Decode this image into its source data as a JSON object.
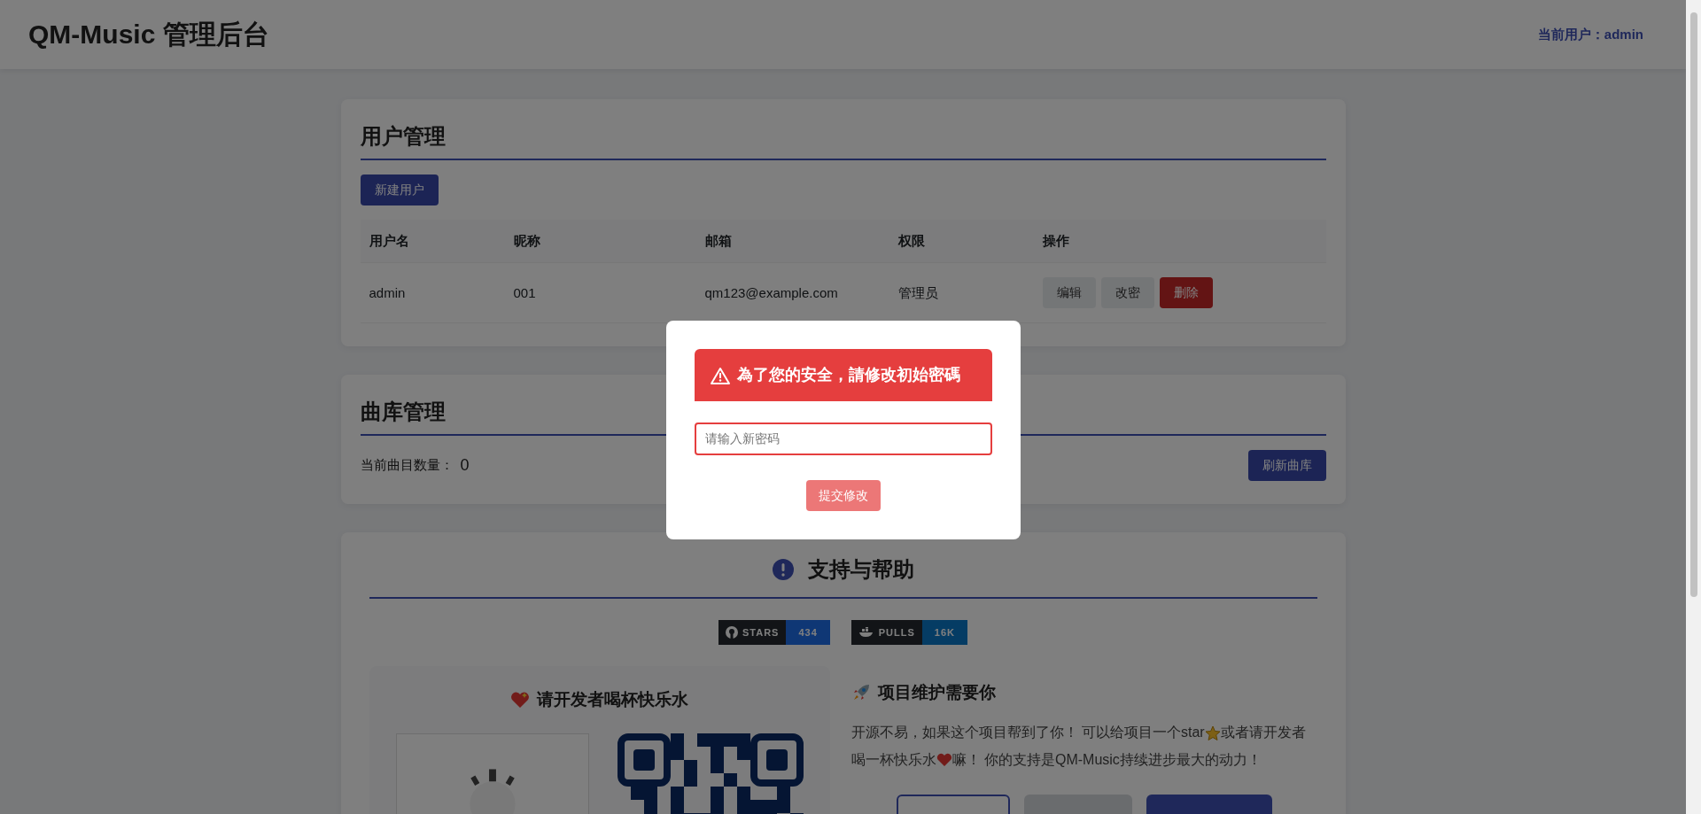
{
  "header": {
    "title": "QM-Music 管理后台",
    "current_user": "当前用户：admin"
  },
  "user_management": {
    "title": "用户管理",
    "new_button": "新建用户",
    "table": {
      "columns": [
        "用户名",
        "昵称",
        "邮箱",
        "权限",
        "操作"
      ],
      "rows": [
        {
          "cells": [
            "admin",
            "001",
            "qm123@example.com",
            "管理员"
          ],
          "actions": [
            {
              "label": "编辑",
              "kind": "secondary"
            },
            {
              "label": "改密",
              "kind": "secondary"
            },
            {
              "label": "删除",
              "kind": "danger"
            }
          ]
        }
      ]
    }
  },
  "library": {
    "title": "曲库管理",
    "count_label": "当前曲目数量：",
    "count": "0",
    "refresh_button": "刷新曲库"
  },
  "support": {
    "title": "支持与帮助",
    "badges": [
      {
        "kind": "github",
        "label": "STARS",
        "value": "434"
      },
      {
        "kind": "docker",
        "label": "PULLS",
        "value": "16K"
      }
    ],
    "donate": {
      "title": "请开发者喝杯快乐水"
    },
    "maintain": {
      "title": "项目维护需要你",
      "lines": [
        [
          {
            "kind": "text",
            "value": "开源不易，如果这个项目帮到了你！ 可以给项目一个star"
          },
          {
            "kind": "star"
          },
          {
            "kind": "text",
            "value": "或者请开发者"
          }
        ],
        [
          {
            "kind": "text",
            "value": "喝一杯快乐水"
          },
          {
            "kind": "heart"
          },
          {
            "kind": "text",
            "value": "嘛！ 你的支持是QM-Music持续进步最大的动力！"
          }
        ]
      ]
    },
    "buttons": [
      {
        "kind": "outline"
      },
      {
        "kind": "secondary"
      },
      {
        "kind": "primary"
      }
    ]
  },
  "modal": {
    "title": "為了您的安全，請修改初始密碼",
    "placeholder": "请输入新密码",
    "submit": {
      "label": "提交修改",
      "disabled": true
    }
  }
}
